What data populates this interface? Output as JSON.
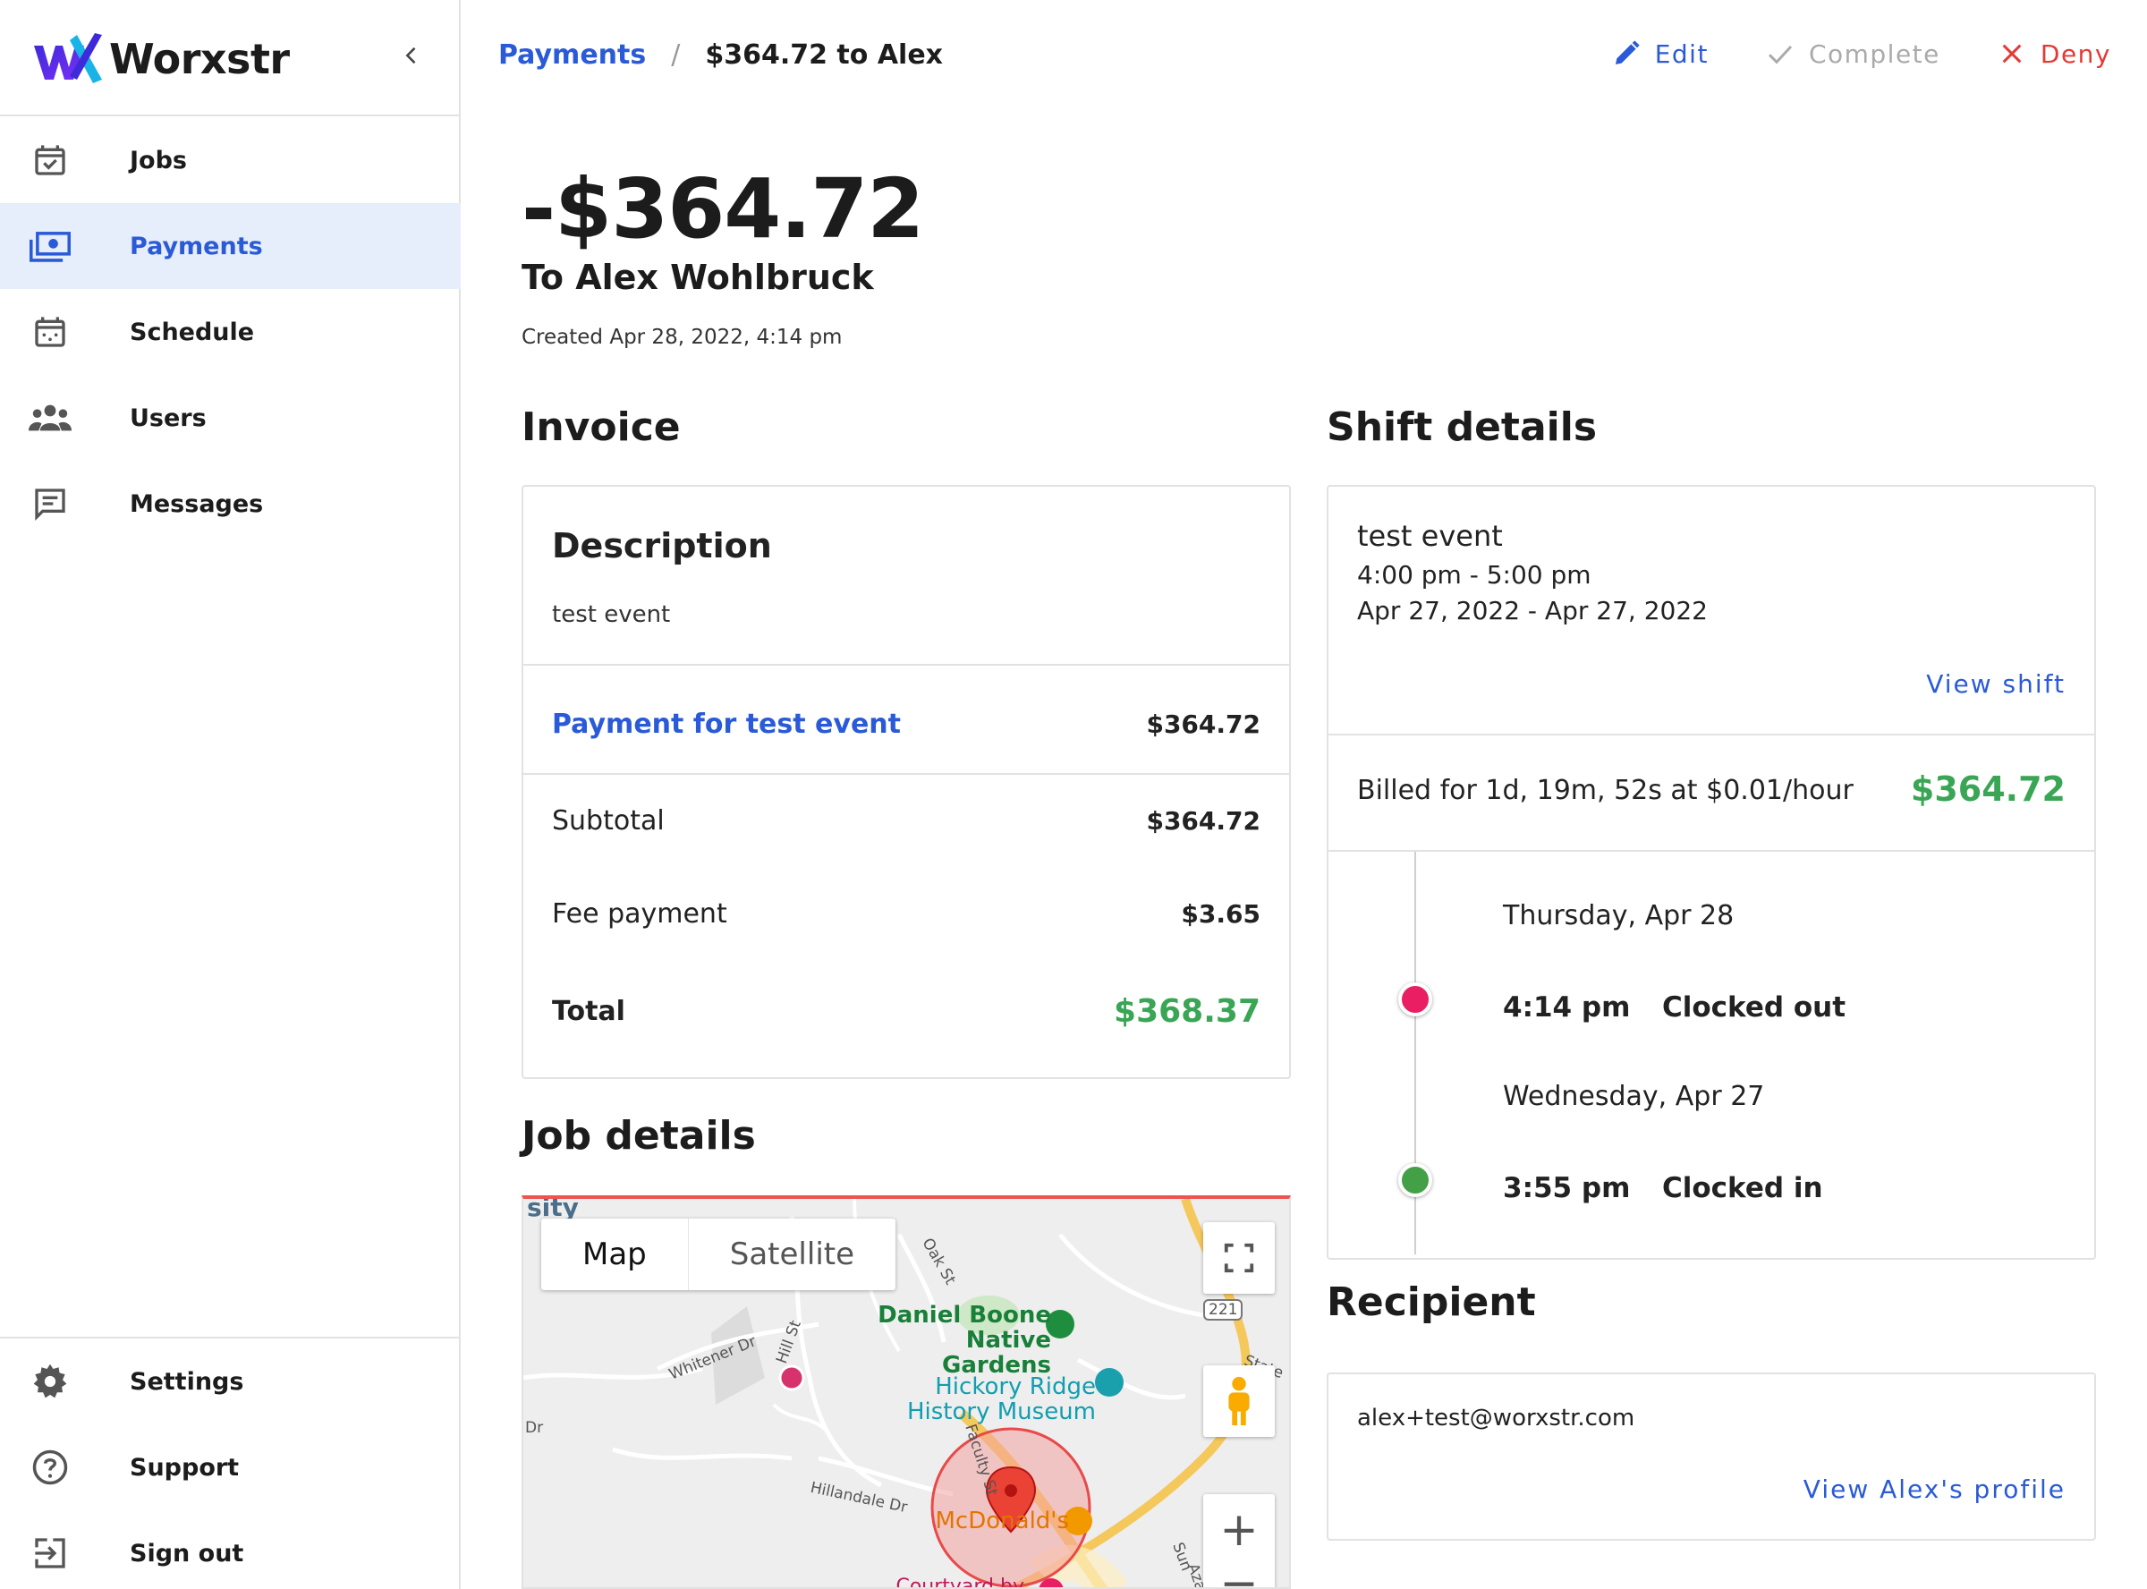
{
  "app": {
    "name": "Worxstr"
  },
  "sidebar": {
    "items": [
      {
        "label": "Jobs",
        "icon": "calendar-check-icon",
        "active": false
      },
      {
        "label": "Payments",
        "icon": "cash-icon",
        "active": true
      },
      {
        "label": "Schedule",
        "icon": "calendar-icon",
        "active": false
      },
      {
        "label": "Users",
        "icon": "users-icon",
        "active": false
      },
      {
        "label": "Messages",
        "icon": "message-icon",
        "active": false
      }
    ],
    "bottom_items": [
      {
        "label": "Settings",
        "icon": "gear-icon"
      },
      {
        "label": "Support",
        "icon": "help-circle-icon"
      },
      {
        "label": "Sign out",
        "icon": "sign-out-icon"
      }
    ]
  },
  "breadcrumb": {
    "parent": "Payments",
    "separator": "/",
    "current": "$364.72 to Alex"
  },
  "actions": {
    "edit": "Edit",
    "complete": "Complete",
    "deny": "Deny"
  },
  "payment": {
    "amount": "-$364.72",
    "to": "To Alex Wohlbruck",
    "created": "Created Apr 28, 2022, 4:14 pm"
  },
  "invoice": {
    "title": "Invoice",
    "description_title": "Description",
    "description": "test event",
    "line_items": [
      {
        "label": "Payment for test event",
        "amount": "$364.72"
      }
    ],
    "subtotal_label": "Subtotal",
    "subtotal": "$364.72",
    "fee_label": "Fee payment",
    "fee": "$3.65",
    "total_label": "Total",
    "total": "$368.37"
  },
  "job_details": {
    "title": "Job details",
    "map": {
      "map_label": "Map",
      "satellite_label": "Satellite",
      "labels": {
        "top_edge": "sity",
        "gardens": "Daniel Boone\nNative Gardens",
        "museum": "Hickory Ridge\nHistory Museum",
        "restaurant": "McDonald's",
        "courtyard": "Courtyard by",
        "oak_st": "Oak St",
        "whitener_dr": "Whitener Dr",
        "hill_st": "Hill St",
        "hillandale_dr": "Hillandale Dr",
        "faculty_st": "Faculty St",
        "state": "State",
        "route": "221",
        "dr": "Dr",
        "sun": "Sun",
        "azalea": "Azale"
      },
      "zoom_in": "+",
      "zoom_out": "−"
    }
  },
  "shift_details": {
    "title": "Shift details",
    "name": "test event",
    "time": "4:00 pm - 5:00 pm",
    "dates": "Apr 27, 2022 - Apr 27, 2022",
    "view_label": "View shift",
    "billed_text": "Billed for 1d, 19m, 52s at $0.01/hour",
    "billed_amount": "$364.72",
    "timeline": [
      {
        "date": "Thursday, Apr 28",
        "time": "4:14 pm",
        "status": "Clocked out",
        "color": "#e91e63"
      },
      {
        "date": "Wednesday, Apr 27",
        "time": "3:55 pm",
        "status": "Clocked in",
        "color": "#43a047"
      }
    ]
  },
  "recipient": {
    "title": "Recipient",
    "email": "alex+test@worxstr.com",
    "profile_label": "View Alex's profile"
  },
  "colors": {
    "accent": "#2a5ad8",
    "success": "#3aa655",
    "danger": "#e53935"
  }
}
